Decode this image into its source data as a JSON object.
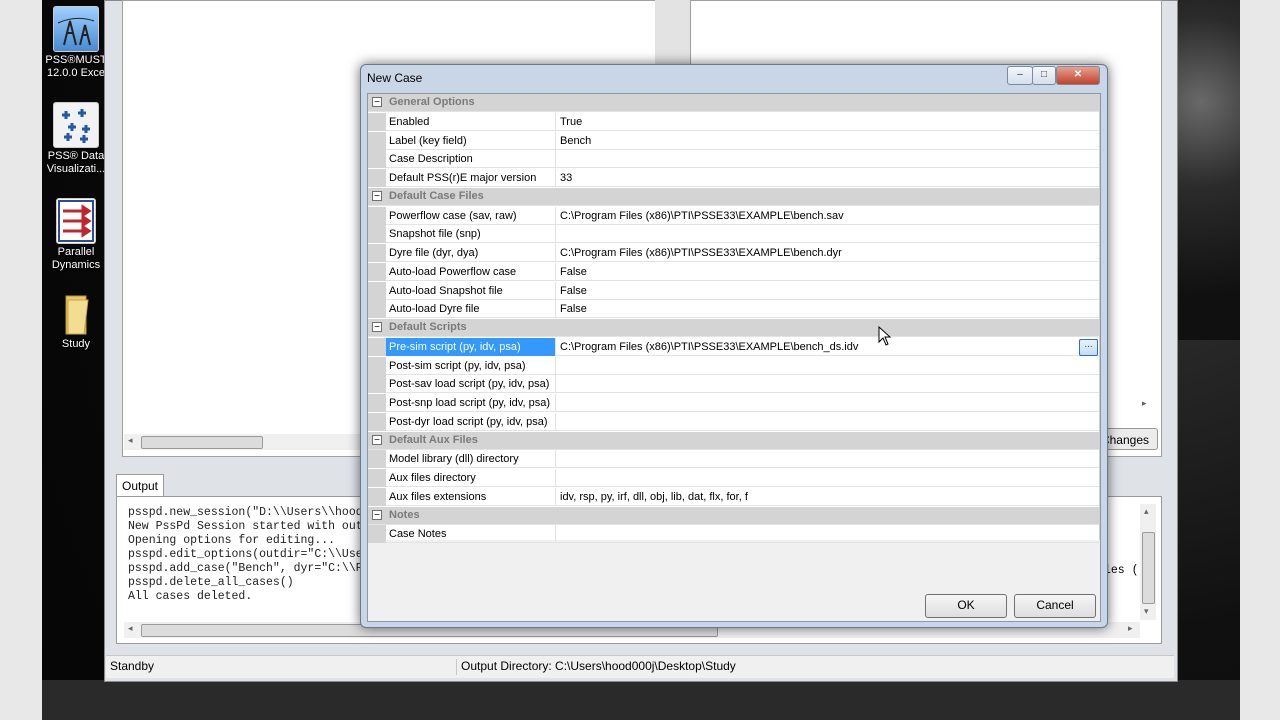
{
  "desktop": {
    "icons": [
      {
        "label": "PSS®MUST 12.0.0 Exce",
        "icon": "pssmust-icon"
      },
      {
        "label": "PSS® Data Visualizati...",
        "icon": "data-visualization-icon"
      },
      {
        "label": "Parallel Dynamics",
        "icon": "parallel-dynamics-icon"
      },
      {
        "label": "Study",
        "icon": "folder-icon"
      }
    ]
  },
  "main_window": {
    "changes_button": "Changes",
    "output_tab": "Output",
    "output_lines": "psspd.new_session(\"D:\\\\Users\\\\hood0\nNew PssPd Session started with outpu\nOpening options for editing...\npsspd.edit_options(outdir=\"C:\\\\User\npsspd.add_case(\"Bench\", dyr=\"C:\\\\Pro\npsspd.delete_all_cases()\nAll cases deleted.",
    "output_right_fragment": "les (",
    "status_left": "Standby",
    "status_right": "Output Directory: C:\\Users\\hood000j\\Desktop\\Study"
  },
  "dialog": {
    "title": "New Case",
    "caption_buttons": {
      "minimize": "–",
      "maximize": "□",
      "close": "✕"
    },
    "ok_label": "OK",
    "cancel_label": "Cancel",
    "ellipsis_label": "...",
    "categories": [
      {
        "label": "General Options",
        "toggle": "−",
        "rows": [
          {
            "name": "Enabled",
            "value": "True"
          },
          {
            "name": "Label (key field)",
            "value": "Bench"
          },
          {
            "name": "Case Description",
            "value": ""
          },
          {
            "name": "Default PSS(r)E major version",
            "value": "33"
          }
        ]
      },
      {
        "label": "Default Case Files",
        "toggle": "−",
        "rows": [
          {
            "name": "Powerflow case (sav, raw)",
            "value": "C:\\Program Files (x86)\\PTI\\PSSE33\\EXAMPLE\\bench.sav"
          },
          {
            "name": "Snapshot file (snp)",
            "value": ""
          },
          {
            "name": "Dyre file (dyr, dya)",
            "value": "C:\\Program Files (x86)\\PTI\\PSSE33\\EXAMPLE\\bench.dyr"
          },
          {
            "name": "Auto-load Powerflow case",
            "value": "False"
          },
          {
            "name": "Auto-load Snapshot file",
            "value": "False"
          },
          {
            "name": "Auto-load Dyre file",
            "value": "False"
          }
        ]
      },
      {
        "label": "Default Scripts",
        "toggle": "−",
        "rows": [
          {
            "name": "Pre-sim script (py, idv, psa)",
            "value": "C:\\Program Files (x86)\\PTI\\PSSE33\\EXAMPLE\\bench_ds.idv",
            "selected": true
          },
          {
            "name": "Post-sim script (py, idv, psa)",
            "value": ""
          },
          {
            "name": "Post-sav load script (py, idv, psa)",
            "value": ""
          },
          {
            "name": "Post-snp load script (py, idv, psa)",
            "value": ""
          },
          {
            "name": "Post-dyr load script (py, idv, psa)",
            "value": ""
          }
        ]
      },
      {
        "label": "Default Aux Files",
        "toggle": "−",
        "rows": [
          {
            "name": "Model library (dll) directory",
            "value": ""
          },
          {
            "name": "Aux files directory",
            "value": ""
          },
          {
            "name": "Aux files extensions",
            "value": "idv, rsp, py, irf, dll, obj, lib, dat, flx, for, f"
          }
        ]
      },
      {
        "label": "Notes",
        "toggle": "−",
        "rows": [
          {
            "name": "Case Notes",
            "value": ""
          }
        ]
      }
    ]
  },
  "colors": {
    "selection": "#3399ff",
    "category_bg": "#d4d4d4",
    "dialog_frame": "#c9d6e6"
  }
}
